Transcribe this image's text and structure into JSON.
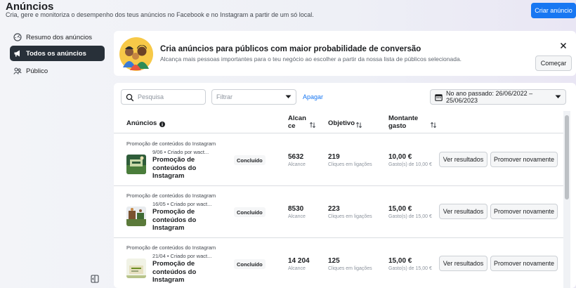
{
  "header": {
    "title": "Anúncios",
    "subtitle": "Cria, gere e monitoriza o desempenho dos teus anúncios no Facebook e no Instagram a partir de um só local.",
    "create_button": "Criar anúncio"
  },
  "sidebar": {
    "items": [
      {
        "label": "Resumo dos anúncios",
        "icon": "gauge-icon"
      },
      {
        "label": "Todos os anúncios",
        "icon": "megaphone-icon",
        "active": true
      },
      {
        "label": "Público",
        "icon": "people-icon"
      }
    ]
  },
  "banner": {
    "title": "Cria anúncios para públicos com maior probabilidade de conversão",
    "description": "Alcança mais pessoas importantes para o teu negócio ao escolher a partir da nossa lista de públicos selecionada.",
    "button": "Começar"
  },
  "toolbar": {
    "search_placeholder": "Pesquisa",
    "filter_placeholder": "Filtrar",
    "clear_label": "Apagar",
    "date_range": "No ano passado: 26/06/2022 – 25/06/2023"
  },
  "table": {
    "headers": {
      "ads": "Anúncios",
      "reach_line1": "Alcan",
      "reach_line2": "ce",
      "objective": "Objetivo",
      "spent_line1": "Montante",
      "spent_line2": "gasto"
    },
    "rows": [
      {
        "category": "Promoção de conteúdos do Instagram",
        "meta": "9/06 • Criado por wact...",
        "name": "Promoção de conteúdos do Instagram",
        "status": "Concluído",
        "reach": "5632",
        "reach_label": "Alcance",
        "objective": "219",
        "objective_label": "Cliques em ligações",
        "spent": "10,00 €",
        "spent_label": "Gasto(s) de 10,00 €",
        "results_button": "Ver resultados",
        "promote_button": "Promover novamente"
      },
      {
        "category": "Promoção de conteúdos do Instagram",
        "meta": "16/05 • Criado por wact...",
        "name": "Promoção de conteúdos do Instagram",
        "status": "Concluído",
        "reach": "8530",
        "reach_label": "Alcance",
        "objective": "223",
        "objective_label": "Cliques em ligações",
        "spent": "15,00 €",
        "spent_label": "Gasto(s) de 15,00 €",
        "results_button": "Ver resultados",
        "promote_button": "Promover novamente"
      },
      {
        "category": "Promoção de conteúdos do Instagram",
        "meta": "21/04 • Criado por wact...",
        "name": "Promoção de conteúdos do Instagram",
        "status": "Concluído",
        "reach": "14 204",
        "reach_label": "Alcance",
        "objective": "125",
        "objective_label": "Cliques em ligações",
        "spent": "15,00 €",
        "spent_label": "Gasto(s) de 15,00 €",
        "results_button": "Ver resultados",
        "promote_button": "Promover novamente"
      }
    ]
  },
  "colors": {
    "primary": "#1877f2",
    "active_nav": "#283039",
    "border": "#ccd0d5"
  }
}
